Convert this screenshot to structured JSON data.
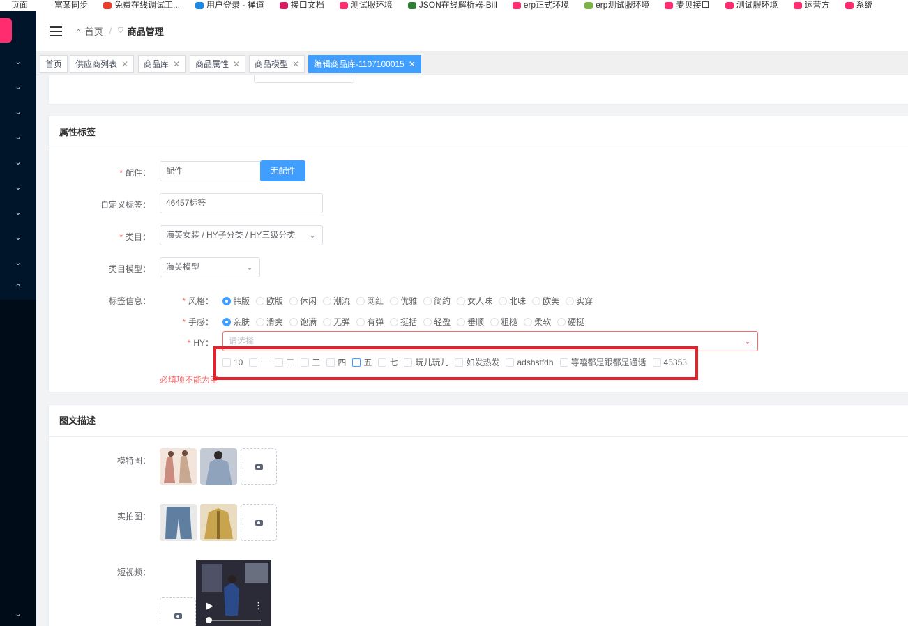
{
  "bookmarks": [
    {
      "label": "页面",
      "color": "#ffffff"
    },
    {
      "label": "富某同步",
      "color": "#ffffff"
    },
    {
      "label": "免费在线调试工...",
      "color": "#e8402a"
    },
    {
      "label": "用户登录 - 禅道",
      "color": "#1e88e5"
    },
    {
      "label": "接口文档",
      "color": "#d81b60"
    },
    {
      "label": "测试服环境",
      "color": "#ff2d6f"
    },
    {
      "label": "JSON在线解析器-Bill",
      "color": "#2e7d32"
    },
    {
      "label": "erp正式环境",
      "color": "#ff2d6f"
    },
    {
      "label": "erp测试服环境",
      "color": "#7cb342"
    },
    {
      "label": "麦贝接口",
      "color": "#ff2d6f"
    },
    {
      "label": "测试服环境",
      "color": "#ff2d6f"
    },
    {
      "label": "运营方",
      "color": "#ff2d6f"
    },
    {
      "label": "系统",
      "color": "#ff2d6f"
    }
  ],
  "sidebar": {
    "items": [
      "⌄",
      "⌄",
      "⌄",
      "⌄",
      "⌄",
      "⌄",
      "⌄",
      "⌄",
      "⌄",
      "⌃"
    ],
    "bottom_item": "⌄"
  },
  "header": {
    "breadcrumb_home": "首页",
    "breadcrumb_sep": "/",
    "breadcrumb_current": "商品管理"
  },
  "tabs": [
    {
      "label": "首页",
      "closable": false
    },
    {
      "label": "供应商列表",
      "closable": true
    },
    {
      "label": "商品库",
      "closable": true
    },
    {
      "label": "商品属性",
      "closable": true
    },
    {
      "label": "商品模型",
      "closable": true
    },
    {
      "label": "编辑商品库-1107100015",
      "closable": true,
      "active": true
    }
  ],
  "close_glyph": "✕",
  "attr_section": {
    "title": "属性标签",
    "accessory_label": "配件：",
    "accessory_value": "配件",
    "no_accessory_button": "无配件",
    "custom_tag_label": "自定义标签：",
    "custom_tag_value": "46457标签",
    "category_label": "类目：",
    "category_value": "海英女装 / HY子分类 / HY三级分类",
    "category_model_label": "类目模型：",
    "category_model_value": "海英模型",
    "tag_info_label": "标签信息：",
    "style_label": "风格：",
    "style_options": [
      "韩版",
      "欧版",
      "休闲",
      "潮流",
      "网红",
      "优雅",
      "简约",
      "女人味",
      "北味",
      "欧美",
      "实穿"
    ],
    "style_selected": "韩版",
    "feel_label": "手感：",
    "feel_options": [
      "亲肤",
      "滑爽",
      "饱满",
      "无弹",
      "有弹",
      "挺括",
      "轻盈",
      "垂顺",
      "粗糙",
      "柔软",
      "硬挺"
    ],
    "feel_selected": "亲肤",
    "hy_label": "HY：",
    "hy_placeholder": "请选择",
    "hy_options": [
      "10",
      "一",
      "二",
      "三",
      "四",
      "五",
      "七",
      "玩儿玩儿",
      "如发热发",
      "adshstfdh",
      "等嘻都是跟都是通话",
      "45353"
    ],
    "hy_focused": "五",
    "error_text": "必填项不能为空"
  },
  "desc_section": {
    "title": "图文描述",
    "model_label": "模特图：",
    "real_label": "实拍图：",
    "video_label": "短视频："
  },
  "colors": {
    "primary": "#409eff",
    "danger": "#f56c6c",
    "sidebar": "#001529",
    "highlight_box": "#e8202a"
  }
}
